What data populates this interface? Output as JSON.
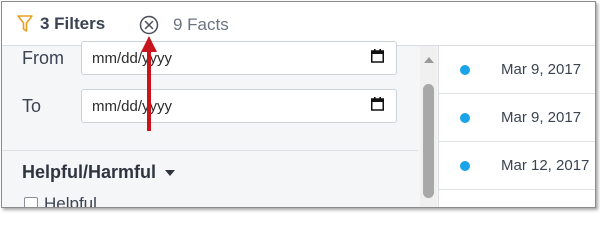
{
  "topbar": {
    "filters_label": "3 Filters",
    "facts_label": "9 Facts",
    "filter_icon_color": "#e8a020",
    "clear_icon": "close-circle-icon",
    "filter_icon": "funnel-icon"
  },
  "date_filter": {
    "from_label": "From",
    "to_label": "To",
    "from_value": "mm/dd/yyyy",
    "to_value": "mm/dd/yyyy",
    "calendar_icon": "calendar-icon"
  },
  "helpful_section": {
    "title": "Helpful/Harmful",
    "option_label": "Helpful"
  },
  "facts_list": {
    "dot_color": "#1aa3e6",
    "items": [
      {
        "date": "Mar 9, 2017"
      },
      {
        "date": "Mar 9, 2017"
      },
      {
        "date": "Mar 12, 2017"
      }
    ]
  },
  "annotation": {
    "arrow_color": "#c8141c"
  }
}
